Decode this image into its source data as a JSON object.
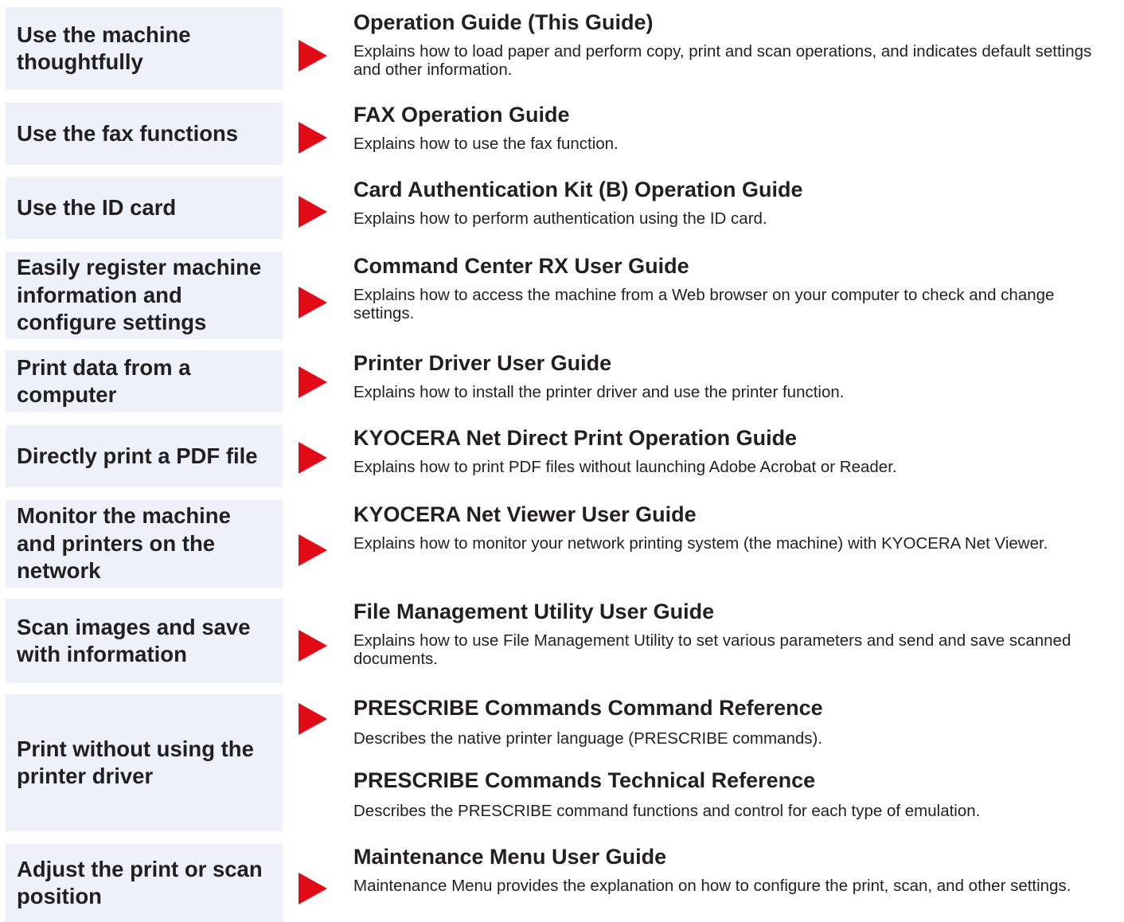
{
  "colors": {
    "task_bg": "#eef1fa",
    "arrow": "#e10b18",
    "text": "#231f20"
  },
  "rows": [
    {
      "task": "Use the machine thoughtfully",
      "guides": [
        {
          "title": "Operation Guide (This Guide)",
          "description": "Explains how to load paper and perform copy, print and scan operations, and indicates default settings and other information."
        }
      ]
    },
    {
      "task": "Use the fax functions",
      "guides": [
        {
          "title": "FAX Operation Guide",
          "description": "Explains how to use the fax function."
        }
      ]
    },
    {
      "task": "Use the ID card",
      "guides": [
        {
          "title": "Card Authentication Kit (B) Operation Guide",
          "description": "Explains how to perform authentication using the ID card."
        }
      ]
    },
    {
      "task": "Easily register machine information and configure settings",
      "guides": [
        {
          "title": "Command Center RX User Guide",
          "description": "Explains how to access the machine from a Web browser on your computer to check and change settings."
        }
      ]
    },
    {
      "task": "Print data from a computer",
      "guides": [
        {
          "title": "Printer Driver User Guide",
          "description": "Explains how to install the printer driver and use the printer function."
        }
      ]
    },
    {
      "task": "Directly print a PDF file",
      "guides": [
        {
          "title": "KYOCERA Net Direct Print Operation Guide",
          "description": "Explains how to print PDF files without launching Adobe Acrobat or Reader."
        }
      ]
    },
    {
      "task": "Monitor the machine and printers on the network",
      "guides": [
        {
          "title": "KYOCERA Net Viewer User Guide",
          "description": "Explains how to monitor your network printing system (the machine) with KYOCERA Net Viewer."
        }
      ]
    },
    {
      "task": "Scan images and save with information",
      "guides": [
        {
          "title": "File Management Utility User Guide",
          "description": "Explains how to use File Management Utility to set various parameters and send and save scanned documents."
        }
      ]
    },
    {
      "task": "Print without using the printer driver",
      "guides": [
        {
          "title": "PRESCRIBE Commands Command Reference",
          "description": "Describes the native printer language (PRESCRIBE commands)."
        },
        {
          "title": "PRESCRIBE Commands Technical Reference",
          "description": "Describes the PRESCRIBE command functions and control for each type of emulation."
        }
      ]
    },
    {
      "task": "Adjust the print or scan position",
      "guides": [
        {
          "title": "Maintenance Menu User Guide",
          "description": "Maintenance Menu provides the explanation on how to configure the print, scan, and other settings."
        }
      ]
    }
  ]
}
